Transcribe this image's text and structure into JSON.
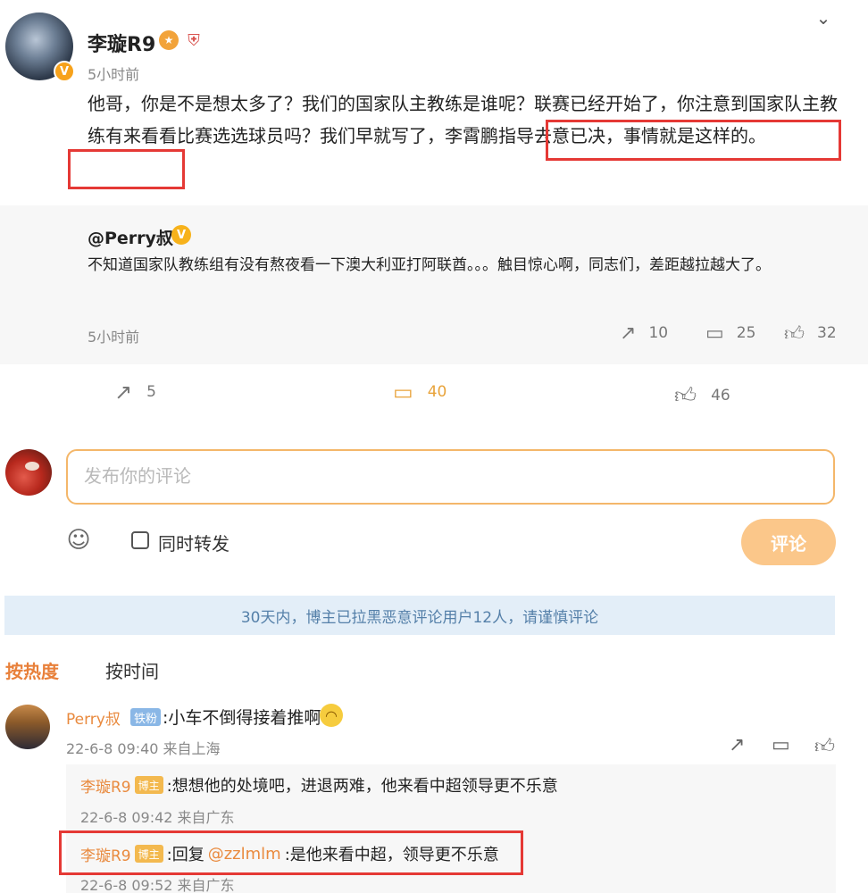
{
  "post": {
    "author": "李璇R9",
    "verified_mark": "V",
    "time": "5小时前",
    "text": "他哥，你是不是想太多了？我们的国家队主教练是谁呢？联赛已经开始了，你注意到国家队主教练有来看看比赛选选球员吗？我们早就写了，李霄鹏指导去意已决，事情就是这样的。",
    "menu_icon": "chevron-down-icon"
  },
  "quote": {
    "author": "@Perry叔",
    "text": "不知道国家队教练组有没有熬夜看一下澳大利亚打阿联酋。。。触目惊心啊，同志们，差距越拉越大了。",
    "time": "5小时前",
    "repost_count": "10",
    "comment_count": "25",
    "like_count": "32"
  },
  "actions": {
    "repost_count": "5",
    "comment_count": "40",
    "like_count": "46"
  },
  "composer": {
    "placeholder": "发布你的评论",
    "same_time_repost": "同时转发",
    "submit": "评论"
  },
  "notice": "30天内，博主已拉黑恶意评论用户12人，请谨慎评论",
  "sort": {
    "hot": "按热度",
    "time": "按时间"
  },
  "comment": {
    "author": "Perry叔",
    "fan_badge": "铁粉",
    "text": ":小车不倒得接着推啊",
    "meta": "22-6-8 09:40 来自上海",
    "replies": [
      {
        "author": "李璇R9",
        "badge": "博主",
        "text": ":想想他的处境吧，进退两难，他来看中超领导更不乐意",
        "meta": "22-6-8 09:42 来自广东"
      },
      {
        "author": "李璇R9",
        "badge": "博主",
        "reply_prefix": ":回复",
        "mention": "@zzlmlm",
        "text": ":是他来看中超，领导更不乐意",
        "meta": "22-6-8 09:52 来自广东"
      }
    ]
  },
  "colors": {
    "accent_orange": "#e8a33b",
    "highlight_red": "#e53935",
    "notice_bg": "#e3eef8",
    "notice_text": "#5580a9"
  }
}
